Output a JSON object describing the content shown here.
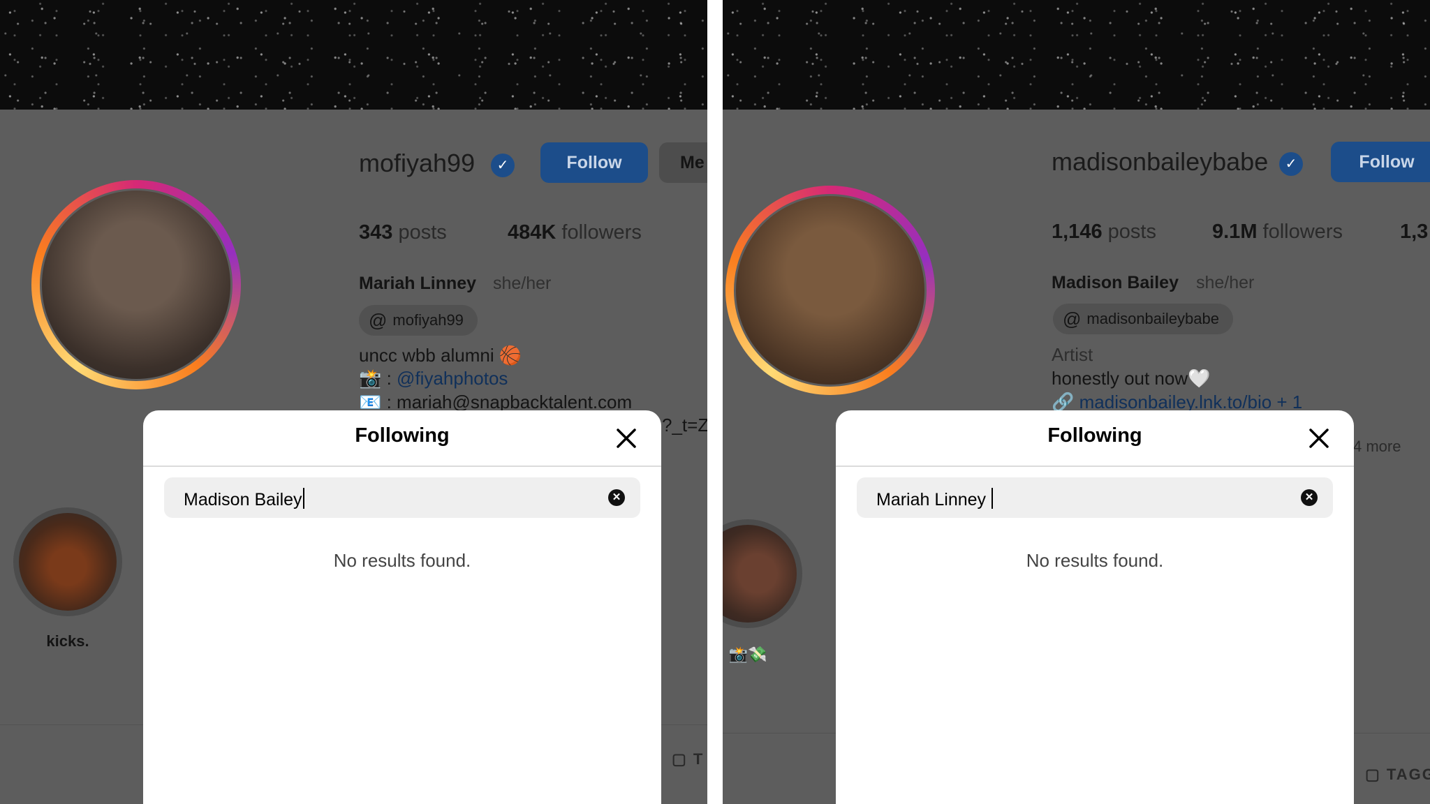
{
  "left": {
    "username": "mofiyah99",
    "follow_label": "Follow",
    "message_label": "Me",
    "stats": {
      "posts_count": "343",
      "posts_label": " posts",
      "followers_count": "484K",
      "followers_label": " followers"
    },
    "display_name": "Mariah Linney",
    "pronouns": "she/her",
    "threads_handle": "mofiyah99",
    "bio_line1": "uncc wbb alumni 🏀",
    "bio_line2_prefix": "📸 : ",
    "bio_line2_link": "@fiyahphotos",
    "bio_line3": "📧 : mariah@snapbacktalent.com",
    "link_fragment": "?_t=Z",
    "highlight_label": "kicks.",
    "tagged_fragment": "T",
    "modal": {
      "title": "Following",
      "search_value": "Madison Bailey",
      "no_results": "No results found."
    }
  },
  "right": {
    "username": "madisonbaileybabe",
    "follow_label": "Follow",
    "stats": {
      "posts_count": "1,146",
      "posts_label": " posts",
      "followers_count": "9.1M",
      "followers_label": " followers",
      "following_partial": "1,3"
    },
    "display_name": "Madison Bailey",
    "pronouns": "she/her",
    "threads_handle": "madisonbaileybabe",
    "category": "Artist",
    "bio_line1": "honestly out now🤍",
    "link": "madisonbailey.lnk.to/bio + 1",
    "more_fragment": "4 more",
    "highlight_label": "📸💸",
    "tagged_fragment": "TAGG",
    "modal": {
      "title": "Following",
      "search_value": "Mariah Linney ",
      "no_results": "No results found."
    }
  },
  "icons": {
    "verified": "verified-badge-icon",
    "threads": "threads-icon",
    "close": "close-icon",
    "clear": "clear-search-icon",
    "link": "link-icon",
    "tagged": "tagged-icon"
  },
  "colors": {
    "accent": "#0095f6",
    "overlay_dim": "#5d5d5d",
    "modal_bg": "#ffffff"
  }
}
